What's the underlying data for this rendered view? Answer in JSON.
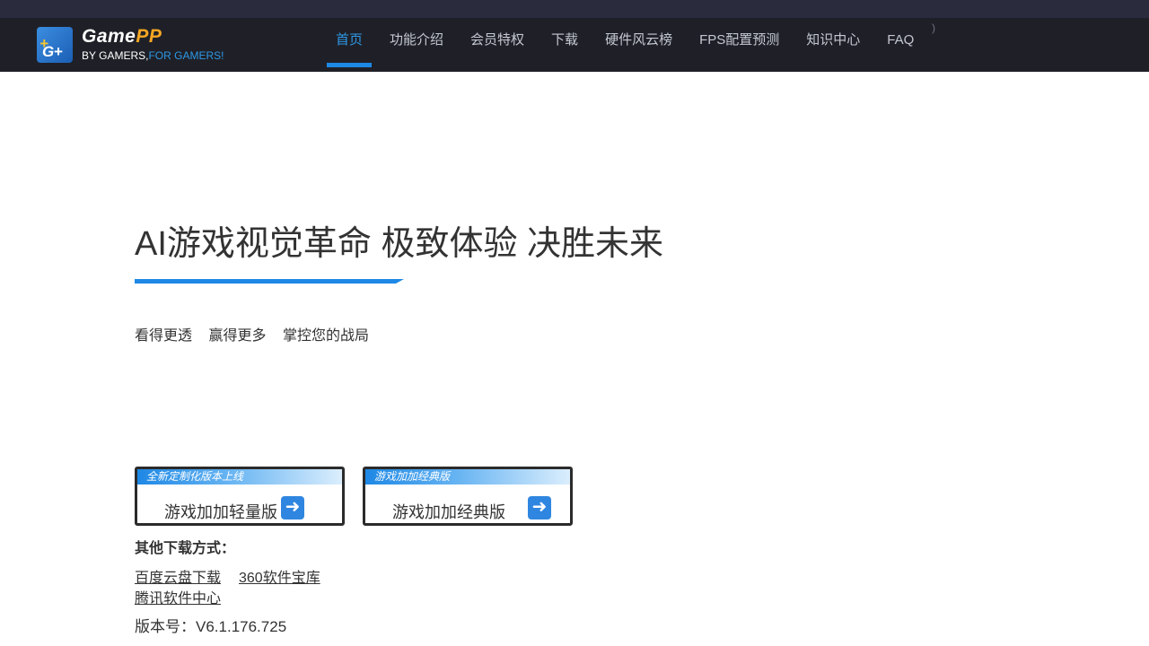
{
  "logo": {
    "badge_text": "G+",
    "badge_plus": "+",
    "brand_main": "Game",
    "brand_accent": "PP",
    "slogan_main": "BY GAMERS,",
    "slogan_accent": "FOR GAMERS!"
  },
  "nav": {
    "items": [
      {
        "label": "首页",
        "active": true
      },
      {
        "label": "功能介绍"
      },
      {
        "label": "会员特权"
      },
      {
        "label": "下载"
      },
      {
        "label": "硬件风云榜"
      },
      {
        "label": "FPS配置预测"
      },
      {
        "label": "知识中心"
      },
      {
        "label": "FAQ"
      }
    ],
    "trailing_glyph": ")"
  },
  "hero": {
    "title": "AI游戏视觉革命 极致体验 决胜未来",
    "slogans": [
      "看得更透",
      "赢得更多",
      "掌控您的战局"
    ]
  },
  "downloads": [
    {
      "tag": "全新定制化版本上线",
      "label": "游戏加加轻量版",
      "icon": "arrow-right-icon"
    },
    {
      "tag": "游戏加加经典版",
      "label": "游戏加加经典版",
      "icon": "arrow-right-icon"
    }
  ],
  "other_downloads": {
    "title": "其他下载方式：",
    "links": [
      "百度云盘下载",
      "360软件宝库",
      "腾讯软件中心"
    ]
  },
  "version": "版本号：V6.1.176.725",
  "colors": {
    "accent": "#1e88e5",
    "nav_bg": "#1f2027",
    "topbar_bg": "#2a2b3d",
    "brand_orange": "#f5a623"
  }
}
